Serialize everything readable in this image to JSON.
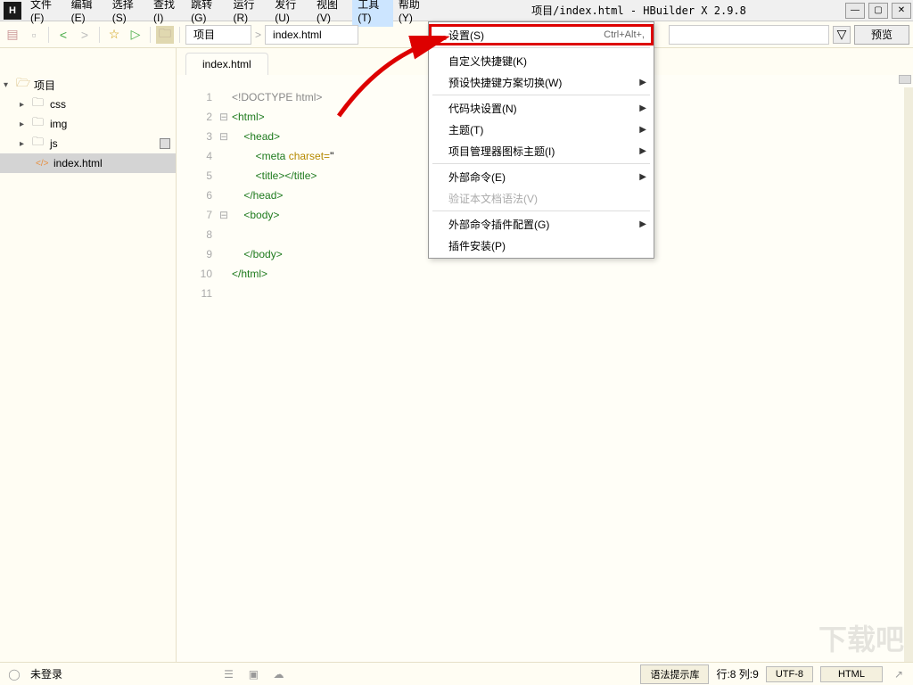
{
  "title": "项目/index.html - HBuilder X 2.9.8",
  "app_icon_letter": "H",
  "menubar": [
    "文件(F)",
    "编辑(E)",
    "选择(S)",
    "查找(I)",
    "跳转(G)",
    "运行(R)",
    "发行(U)",
    "视图(V)",
    "工具(T)",
    "帮助(Y)"
  ],
  "active_menu_index": 8,
  "toolbar": {
    "breadcrumb": [
      "项目",
      "index.html"
    ],
    "preview_label": "预览"
  },
  "sidebar": {
    "root": "项目",
    "folders": [
      "css",
      "img",
      "js"
    ],
    "file": "index.html"
  },
  "tab_label": "index.html",
  "code": {
    "lines": [
      {
        "n": "1",
        "fold": "",
        "html": "<span class='doctype'>&lt;!DOCTYPE html&gt;</span>"
      },
      {
        "n": "2",
        "fold": "⊟",
        "html": "<span class='tag'>&lt;html&gt;</span>"
      },
      {
        "n": "3",
        "fold": "⊟",
        "html": "    <span class='tag'>&lt;head&gt;</span>"
      },
      {
        "n": "4",
        "fold": "",
        "html": "        <span class='tag'>&lt;meta</span> <span class='attr'>charset=</span>\""
      },
      {
        "n": "5",
        "fold": "",
        "html": "        <span class='tag'>&lt;title&gt;&lt;/title&gt;</span>"
      },
      {
        "n": "6",
        "fold": "",
        "html": "    <span class='tag'>&lt;/head&gt;</span>"
      },
      {
        "n": "7",
        "fold": "⊟",
        "html": "    <span class='tag'>&lt;body&gt;</span>"
      },
      {
        "n": "8",
        "fold": "",
        "html": "        "
      },
      {
        "n": "9",
        "fold": "",
        "html": "    <span class='tag'>&lt;/body&gt;</span>"
      },
      {
        "n": "10",
        "fold": "",
        "html": "<span class='tag'>&lt;/html&gt;</span>"
      },
      {
        "n": "11",
        "fold": "",
        "html": ""
      }
    ]
  },
  "dropdown": [
    {
      "type": "item",
      "label": "设置(S)",
      "shortcut": "Ctrl+Alt+,",
      "highlighted": true
    },
    {
      "type": "sep"
    },
    {
      "type": "item",
      "label": "自定义快捷键(K)"
    },
    {
      "type": "item",
      "label": "预设快捷键方案切换(W)",
      "sub": true
    },
    {
      "type": "sep"
    },
    {
      "type": "item",
      "label": "代码块设置(N)",
      "sub": true
    },
    {
      "type": "item",
      "label": "主题(T)",
      "sub": true
    },
    {
      "type": "item",
      "label": "项目管理器图标主题(I)",
      "sub": true
    },
    {
      "type": "sep"
    },
    {
      "type": "item",
      "label": "外部命令(E)",
      "sub": true
    },
    {
      "type": "item",
      "label": "验证本文档语法(V)",
      "disabled": true
    },
    {
      "type": "sep"
    },
    {
      "type": "item",
      "label": "外部命令插件配置(G)",
      "sub": true
    },
    {
      "type": "item",
      "label": "插件安装(P)"
    }
  ],
  "statusbar": {
    "login": "未登录",
    "syntax": "语法提示库",
    "pos": "行:8 列:9",
    "encoding": "UTF-8",
    "lang": "HTML"
  },
  "watermark": "下载吧"
}
